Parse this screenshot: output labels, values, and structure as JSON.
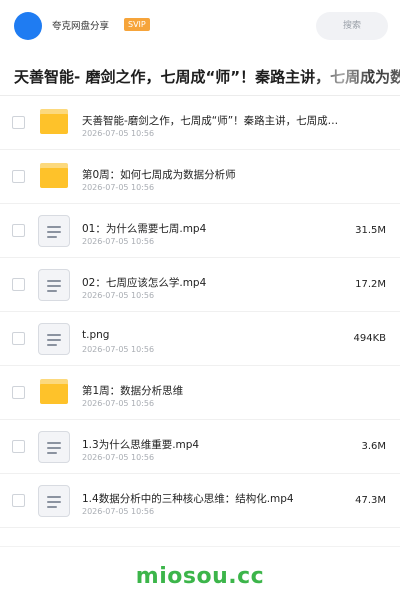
{
  "header": {
    "share_name": "夸克网盘分享",
    "badge": "SVIP",
    "search_label": "搜索"
  },
  "folder": {
    "title": "天善智能- 磨剑之作，七周成“师”！秦路主讲，七周成为数"
  },
  "files": [
    {
      "type": "folder",
      "name": "天善智能-磨剑之作，七周成“师”！秦路主讲，七周成…",
      "date": "2026-07-05 10:56",
      "size": ""
    },
    {
      "type": "folder",
      "name": "第0周：如何七周成为数据分析师",
      "date": "2026-07-05 10:56",
      "size": ""
    },
    {
      "type": "file",
      "name": "01：为什么需要七周.mp4",
      "date": "2026-07-05 10:56",
      "size": "31.5M"
    },
    {
      "type": "file",
      "name": "02：七周应该怎么学.mp4",
      "date": "2026-07-05 10:56",
      "size": "17.2M"
    },
    {
      "type": "file",
      "name": "t.png",
      "date": "2026-07-05 10:56",
      "size": "494KB"
    },
    {
      "type": "folder",
      "name": "第1周：数据分析思维",
      "date": "2026-07-05 10:56",
      "size": ""
    },
    {
      "type": "file",
      "name": "1.3为什么思维重要.mp4",
      "date": "2026-07-05 10:56",
      "size": "3.6M"
    },
    {
      "type": "file",
      "name": "1.4数据分析中的三种核心思维：结构化.mp4",
      "date": "2026-07-05 10:56",
      "size": "47.3M"
    }
  ],
  "footer": {
    "watermark": "miosou.cc"
  },
  "colors": {
    "avatar": "#1f7cf2",
    "svip": "#f6a43a",
    "folder": "#fec22a",
    "watermark": "#3cb54a"
  }
}
